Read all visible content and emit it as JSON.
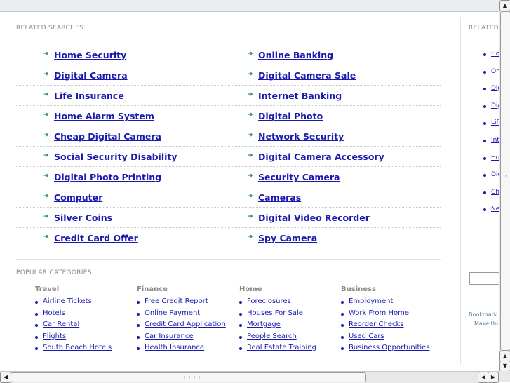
{
  "related": {
    "title": "RELATED SEARCHES",
    "left": [
      "Home Security",
      "Digital Camera",
      "Life Insurance",
      "Home Alarm System",
      "Cheap Digital Camera",
      "Social Security Disability",
      "Digital Photo Printing",
      "Computer",
      "Silver Coins",
      "Credit Card Offer"
    ],
    "right": [
      "Online Banking",
      "Digital Camera Sale",
      "Internet Banking",
      "Digital Photo",
      "Network Security",
      "Digital Camera Accessory",
      "Security Camera",
      "Cameras",
      "Digital Video Recorder",
      "Spy Camera"
    ],
    "arrow_glyph": "➜"
  },
  "popular": {
    "title": "POPULAR CATEGORIES",
    "columns": [
      {
        "heading": "Travel",
        "links": [
          "Airline Tickets",
          "Hotels",
          "Car Rental",
          "Flights",
          "South Beach Hotels"
        ]
      },
      {
        "heading": "Finance",
        "links": [
          "Free Credit Report",
          "Online Payment",
          "Credit Card Application",
          "Car Insurance",
          "Health Insurance"
        ]
      },
      {
        "heading": "Home",
        "links": [
          "Foreclosures",
          "Houses For Sale",
          "Mortgage",
          "People Search",
          "Real Estate Training"
        ]
      },
      {
        "heading": "Business",
        "links": [
          "Employment",
          "Work From Home",
          "Reorder Checks",
          "Used Cars",
          "Business Opportunities"
        ]
      }
    ]
  },
  "right_panel": {
    "title": "RELATED",
    "links": [
      "Ho",
      "On",
      "Dig",
      "Dig",
      "Life",
      "Inte",
      "Ho",
      "Dig",
      "Ch",
      "Ne"
    ],
    "bookmark_text": "Bookmark",
    "make_text": "Make thi"
  },
  "scrollbars": {
    "up": "▲",
    "down": "▼",
    "left": "◀",
    "right": "▶",
    "grip_h": "⋮⋮⋮⋮",
    "grip_v": "⋯"
  }
}
